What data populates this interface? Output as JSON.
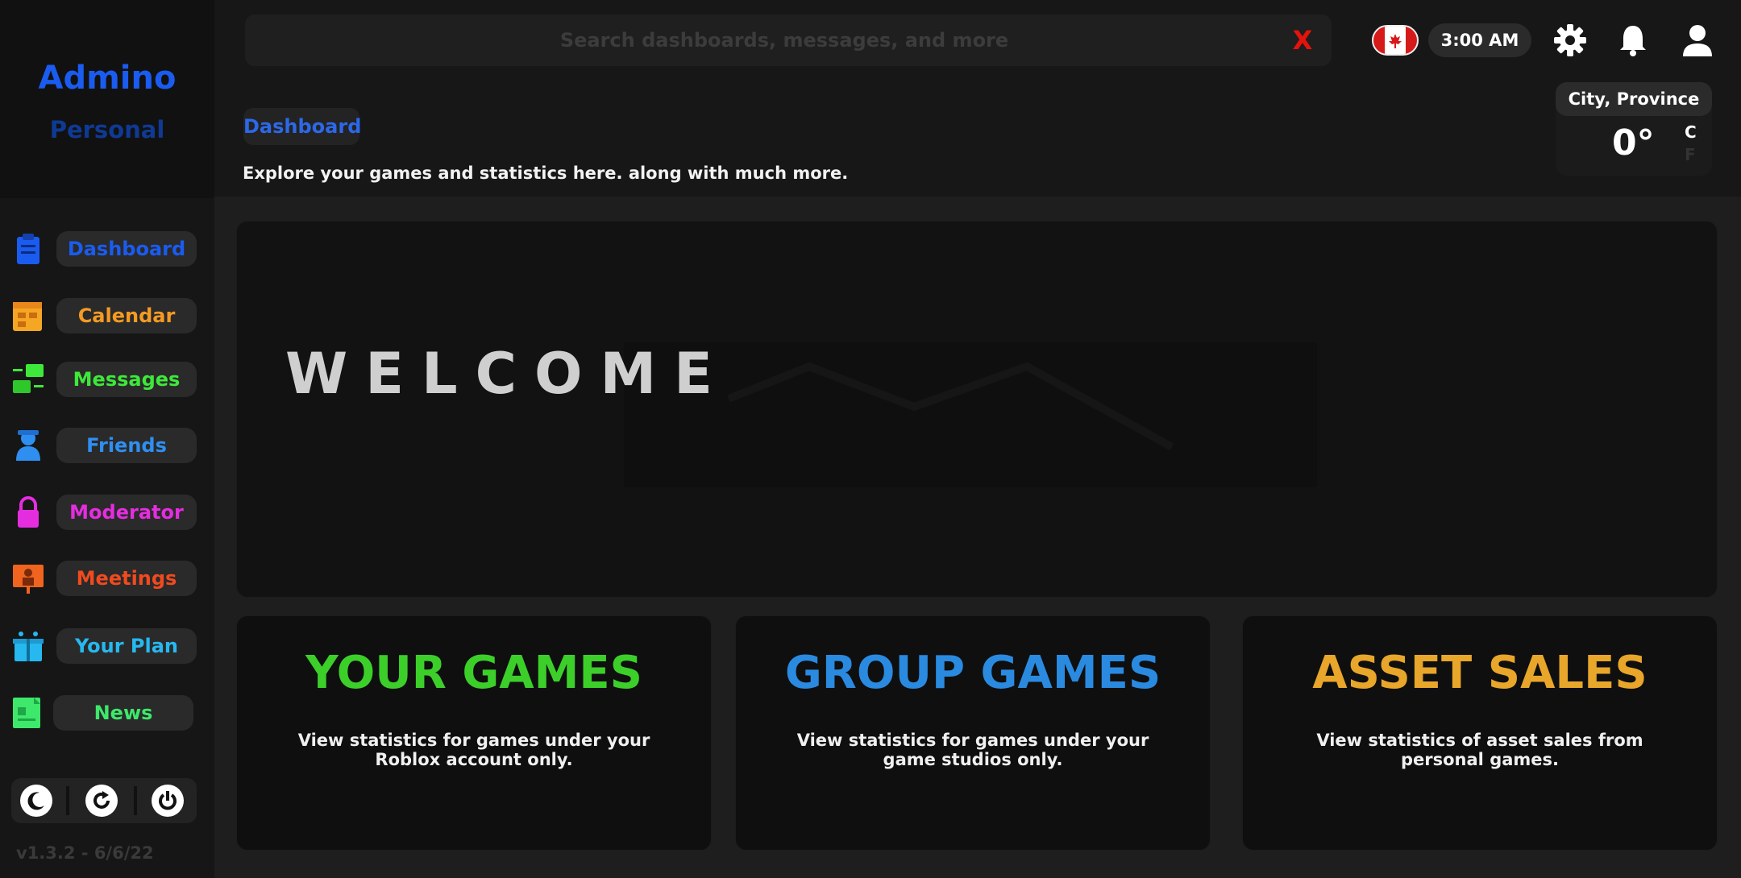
{
  "brand": {
    "title": "Admino",
    "subtitle": "Personal"
  },
  "sidebar": {
    "items": [
      {
        "label": "Dashboard",
        "color": "#1a5cf0",
        "icon": "clipboard-icon"
      },
      {
        "label": "Calendar",
        "color": "#f59a23",
        "icon": "calendar-icon"
      },
      {
        "label": "Messages",
        "color": "#3ee83a",
        "icon": "envelopes-icon"
      },
      {
        "label": "Friends",
        "color": "#2f8ff0",
        "icon": "person-icon"
      },
      {
        "label": "Moderator",
        "color": "#e52de0",
        "icon": "lock-icon"
      },
      {
        "label": "Meetings",
        "color": "#f04a1f",
        "icon": "presentation-icon"
      },
      {
        "label": "Your Plan",
        "color": "#27b8f0",
        "icon": "gift-icon"
      },
      {
        "label": "News",
        "color": "#3de86a",
        "icon": "newspaper-icon"
      }
    ],
    "controls": [
      "moon-icon",
      "refresh-icon",
      "power-icon"
    ],
    "version": "v1.3.2 - 6/6/22"
  },
  "header": {
    "search_placeholder": "Search dashboards, messages, and more",
    "clear_label": "X",
    "time": "3:00 AM",
    "flag": "canada-flag-icon",
    "icons": [
      "gear-icon",
      "bell-icon",
      "user-icon"
    ]
  },
  "page": {
    "tag": "Dashboard",
    "subtitle": "Explore your games and statistics here. along with much more."
  },
  "weather": {
    "location": "City, Province",
    "temperature": "0°",
    "unit_c": "C",
    "unit_f": "F"
  },
  "hero": {
    "title": "WELCOME"
  },
  "cards": [
    {
      "title": "YOUR GAMES",
      "description": "View statistics for games under your Roblox account only.",
      "color": "#3ccf2a"
    },
    {
      "title": "GROUP GAMES",
      "description": "View statistics for games under your game studios only.",
      "color": "#2a8ae0"
    },
    {
      "title": "ASSET SALES",
      "description": "View statistics of asset sales from personal games.",
      "color": "#e8a62a"
    }
  ]
}
